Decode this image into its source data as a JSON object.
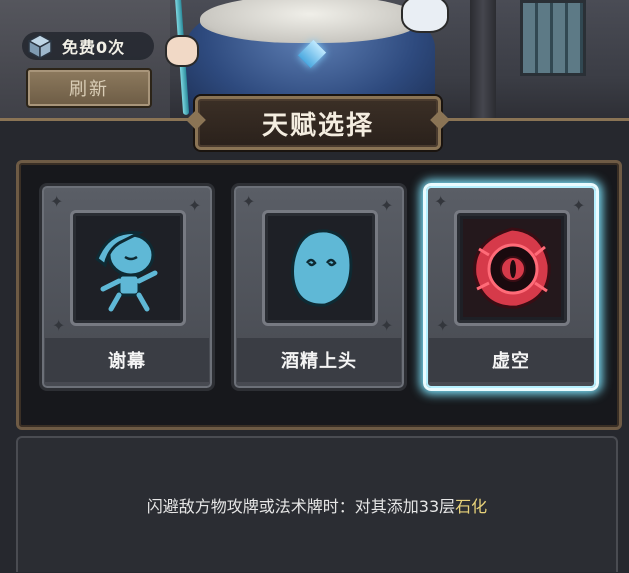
{
  "header": {
    "free_label": "免费0次",
    "refresh_label": "刷新"
  },
  "title": "天赋选择",
  "talents": [
    {
      "name": "谢幕",
      "icon": "curtain-figure-icon",
      "selected": false
    },
    {
      "name": "酒精上头",
      "icon": "drunk-face-icon",
      "selected": false
    },
    {
      "name": "虚空",
      "icon": "void-eye-icon",
      "selected": true
    }
  ],
  "description": {
    "text": "闪避敌方物攻牌或法术牌时：对其添加33层",
    "highlight": "石化"
  },
  "colors": {
    "highlight": "#e8d27a",
    "selected_glow": "#7fe6ff",
    "icon_blue": "#5fb8d6",
    "icon_red": "#d63a4a"
  }
}
